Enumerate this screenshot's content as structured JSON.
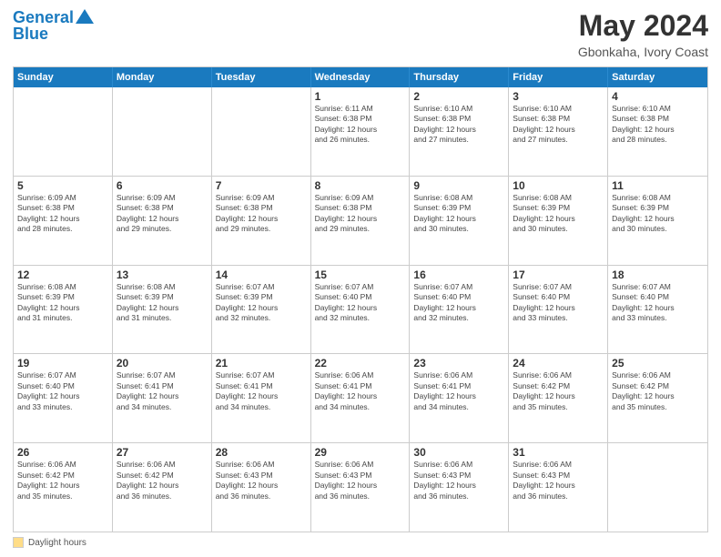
{
  "header": {
    "logo_line1": "General",
    "logo_line2": "Blue",
    "month_year": "May 2024",
    "location": "Gbonkaha, Ivory Coast"
  },
  "weekdays": [
    "Sunday",
    "Monday",
    "Tuesday",
    "Wednesday",
    "Thursday",
    "Friday",
    "Saturday"
  ],
  "weeks": [
    [
      {
        "day": "",
        "info": ""
      },
      {
        "day": "",
        "info": ""
      },
      {
        "day": "",
        "info": ""
      },
      {
        "day": "1",
        "info": "Sunrise: 6:11 AM\nSunset: 6:38 PM\nDaylight: 12 hours\nand 26 minutes."
      },
      {
        "day": "2",
        "info": "Sunrise: 6:10 AM\nSunset: 6:38 PM\nDaylight: 12 hours\nand 27 minutes."
      },
      {
        "day": "3",
        "info": "Sunrise: 6:10 AM\nSunset: 6:38 PM\nDaylight: 12 hours\nand 27 minutes."
      },
      {
        "day": "4",
        "info": "Sunrise: 6:10 AM\nSunset: 6:38 PM\nDaylight: 12 hours\nand 28 minutes."
      }
    ],
    [
      {
        "day": "5",
        "info": "Sunrise: 6:09 AM\nSunset: 6:38 PM\nDaylight: 12 hours\nand 28 minutes."
      },
      {
        "day": "6",
        "info": "Sunrise: 6:09 AM\nSunset: 6:38 PM\nDaylight: 12 hours\nand 29 minutes."
      },
      {
        "day": "7",
        "info": "Sunrise: 6:09 AM\nSunset: 6:38 PM\nDaylight: 12 hours\nand 29 minutes."
      },
      {
        "day": "8",
        "info": "Sunrise: 6:09 AM\nSunset: 6:38 PM\nDaylight: 12 hours\nand 29 minutes."
      },
      {
        "day": "9",
        "info": "Sunrise: 6:08 AM\nSunset: 6:39 PM\nDaylight: 12 hours\nand 30 minutes."
      },
      {
        "day": "10",
        "info": "Sunrise: 6:08 AM\nSunset: 6:39 PM\nDaylight: 12 hours\nand 30 minutes."
      },
      {
        "day": "11",
        "info": "Sunrise: 6:08 AM\nSunset: 6:39 PM\nDaylight: 12 hours\nand 30 minutes."
      }
    ],
    [
      {
        "day": "12",
        "info": "Sunrise: 6:08 AM\nSunset: 6:39 PM\nDaylight: 12 hours\nand 31 minutes."
      },
      {
        "day": "13",
        "info": "Sunrise: 6:08 AM\nSunset: 6:39 PM\nDaylight: 12 hours\nand 31 minutes."
      },
      {
        "day": "14",
        "info": "Sunrise: 6:07 AM\nSunset: 6:39 PM\nDaylight: 12 hours\nand 32 minutes."
      },
      {
        "day": "15",
        "info": "Sunrise: 6:07 AM\nSunset: 6:40 PM\nDaylight: 12 hours\nand 32 minutes."
      },
      {
        "day": "16",
        "info": "Sunrise: 6:07 AM\nSunset: 6:40 PM\nDaylight: 12 hours\nand 32 minutes."
      },
      {
        "day": "17",
        "info": "Sunrise: 6:07 AM\nSunset: 6:40 PM\nDaylight: 12 hours\nand 33 minutes."
      },
      {
        "day": "18",
        "info": "Sunrise: 6:07 AM\nSunset: 6:40 PM\nDaylight: 12 hours\nand 33 minutes."
      }
    ],
    [
      {
        "day": "19",
        "info": "Sunrise: 6:07 AM\nSunset: 6:40 PM\nDaylight: 12 hours\nand 33 minutes."
      },
      {
        "day": "20",
        "info": "Sunrise: 6:07 AM\nSunset: 6:41 PM\nDaylight: 12 hours\nand 34 minutes."
      },
      {
        "day": "21",
        "info": "Sunrise: 6:07 AM\nSunset: 6:41 PM\nDaylight: 12 hours\nand 34 minutes."
      },
      {
        "day": "22",
        "info": "Sunrise: 6:06 AM\nSunset: 6:41 PM\nDaylight: 12 hours\nand 34 minutes."
      },
      {
        "day": "23",
        "info": "Sunrise: 6:06 AM\nSunset: 6:41 PM\nDaylight: 12 hours\nand 34 minutes."
      },
      {
        "day": "24",
        "info": "Sunrise: 6:06 AM\nSunset: 6:42 PM\nDaylight: 12 hours\nand 35 minutes."
      },
      {
        "day": "25",
        "info": "Sunrise: 6:06 AM\nSunset: 6:42 PM\nDaylight: 12 hours\nand 35 minutes."
      }
    ],
    [
      {
        "day": "26",
        "info": "Sunrise: 6:06 AM\nSunset: 6:42 PM\nDaylight: 12 hours\nand 35 minutes."
      },
      {
        "day": "27",
        "info": "Sunrise: 6:06 AM\nSunset: 6:42 PM\nDaylight: 12 hours\nand 36 minutes."
      },
      {
        "day": "28",
        "info": "Sunrise: 6:06 AM\nSunset: 6:43 PM\nDaylight: 12 hours\nand 36 minutes."
      },
      {
        "day": "29",
        "info": "Sunrise: 6:06 AM\nSunset: 6:43 PM\nDaylight: 12 hours\nand 36 minutes."
      },
      {
        "day": "30",
        "info": "Sunrise: 6:06 AM\nSunset: 6:43 PM\nDaylight: 12 hours\nand 36 minutes."
      },
      {
        "day": "31",
        "info": "Sunrise: 6:06 AM\nSunset: 6:43 PM\nDaylight: 12 hours\nand 36 minutes."
      },
      {
        "day": "",
        "info": ""
      }
    ]
  ],
  "footer": {
    "daylight_label": "Daylight hours"
  }
}
